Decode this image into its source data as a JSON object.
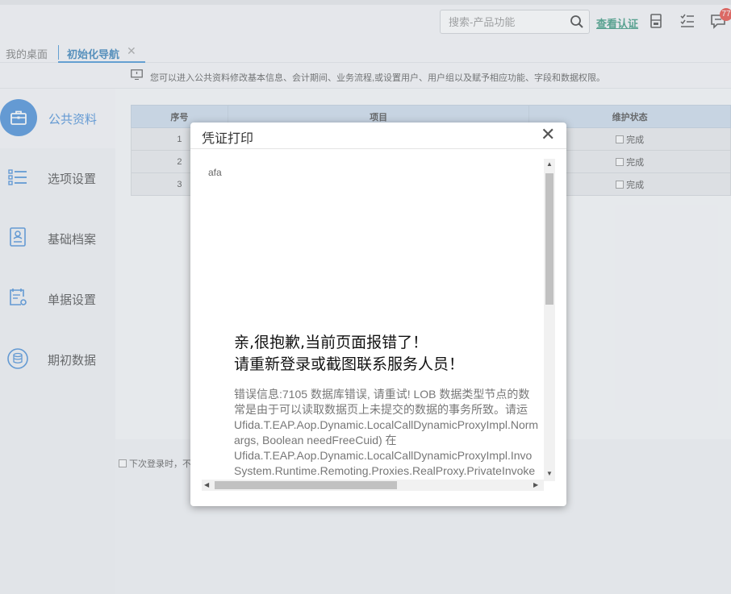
{
  "header": {
    "search_placeholder": "搜索-产品功能",
    "auth_link": "查看认证",
    "badge_count": "77"
  },
  "tabs": [
    {
      "label": "我的桌面"
    },
    {
      "label": "初始化导航"
    }
  ],
  "notice": "您可以进入公共资料修改基本信息、会计期间、业务流程,或设置用户、用户组以及赋予相应功能、字段和数据权限。",
  "sidebar": {
    "items": [
      {
        "label": "公共资料",
        "icon": "briefcase-icon"
      },
      {
        "label": "选项设置",
        "icon": "list-icon"
      },
      {
        "label": "基础档案",
        "icon": "profile-card-icon"
      },
      {
        "label": "单据设置",
        "icon": "document-settings-icon"
      },
      {
        "label": "期初数据",
        "icon": "database-icon"
      }
    ]
  },
  "table": {
    "headers": [
      "序号",
      "项目",
      "维护状态"
    ],
    "rows": [
      {
        "no": "1",
        "status": "完成"
      },
      {
        "no": "2",
        "status": "完成"
      },
      {
        "no": "3",
        "status": "完成"
      }
    ]
  },
  "footer": {
    "checkbox_label": "下次登录时，不"
  },
  "modal": {
    "title": "凭证打印",
    "frame_label": "afa",
    "error_title_line1": "亲,很抱歉,当前页面报错了！",
    "error_title_line2": "请重新登录或截图联系服务人员！",
    "error_lines": [
      "错误信息:7105 数据库错误, 请重试! LOB 数据类型节点的数",
      "常是由于可以读取数据页上未提交的数据的事务所致。请运",
      "Ufida.T.EAP.Aop.Dynamic.LocalCallDynamicProxyImpl.Norm",
      "args, Boolean needFreeCuid) 在",
      "Ufida.T.EAP.Aop.Dynamic.LocalCallDynamicProxyImpl.Invo",
      "System.Runtime.Remoting.Proxies.RealProxy.PrivateInvoke"
    ]
  },
  "colors": {
    "accent": "#2f7fd3",
    "auth_link": "#1f8a6e",
    "badge": "#e5332a",
    "table_header": "#c6d7ea"
  }
}
